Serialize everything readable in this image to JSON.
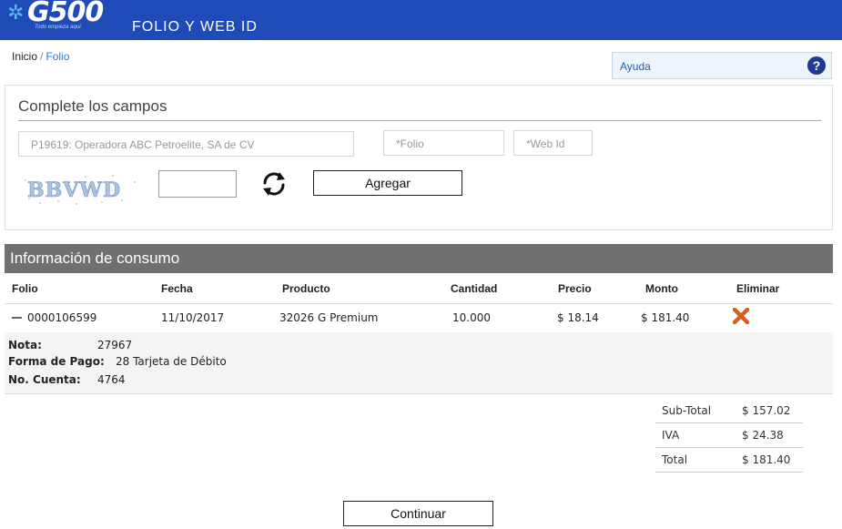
{
  "header": {
    "logo_text": "G500",
    "logo_tagline": "Todo empieza aquí",
    "title": "FOLIO Y WEB ID",
    "bar_color": "#1e4bb8"
  },
  "breadcrumb": {
    "home": "Inicio",
    "separator": "/",
    "current": "Folio"
  },
  "help": {
    "label": "Ayuda",
    "icon": "?"
  },
  "form": {
    "title": "Complete los campos",
    "company_placeholder": "P19619: Operadora ABC Petroelite, SA de CV",
    "folio_placeholder": "*Folio",
    "webid_placeholder": "*Web Id",
    "captcha_text": "BBVWD",
    "captcha_value": "",
    "add_button": "Agregar"
  },
  "consumption": {
    "title": "Información de consumo",
    "columns": [
      "Folio",
      "Fecha",
      "Producto",
      "Cantidad",
      "Precio",
      "Monto",
      "Eliminar"
    ],
    "rows": [
      {
        "folio": "0000106599",
        "fecha": "11/10/2017",
        "producto": "32026 G Premium",
        "cantidad": "10.000",
        "precio": "$ 18.14",
        "monto": "$ 181.40",
        "delete_icon": "close-x",
        "delete_color": "#d3601f"
      }
    ],
    "detail": {
      "nota_label": "Nota:",
      "nota_value": "27967",
      "pago_label": "Forma de Pago:",
      "pago_value": "28 Tarjeta de Débito",
      "cuenta_label": "No. Cuenta:",
      "cuenta_value": "4764"
    }
  },
  "totals": {
    "subtotal_label": "Sub-Total",
    "subtotal_value": "$ 157.02",
    "iva_label": "IVA",
    "iva_value": "$ 24.38",
    "total_label": "Total",
    "total_value": "$ 181.40"
  },
  "continue_button": "Continuar"
}
